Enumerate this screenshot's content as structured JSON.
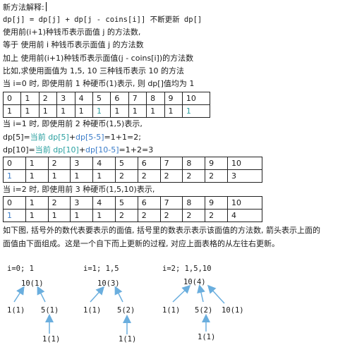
{
  "lines": {
    "l1": "新方法解释:",
    "l2": "dp[j] = dp[j] + dp[j - coins[i]] 不断更新 dp[]",
    "l3": "使用前(i+1)种钱币表示面值 j 的方法数,",
    "l4": "等于   使用前 i 种钱币表示面值 j 的方法数",
    "l5": "加上   使用前(i+1)种钱币表示面值(j - coins[i])的方法数",
    "l6": "比如,求使用面值为 1,5, 10 三种钱币表示 10 的方法",
    "l7": "当 i=0 时, 即使用前 1 种硬币(1)表示, 则 dp[]值均为 1",
    "l8": "当 i=1 时, 即使用前 2 种硬币(1,5)表示,",
    "l10": "当 i=2 时, 即使用前 3 种硬币(1,5,10)表示,",
    "l11": "如下图, 括号外的数代表要表示的面值, 括号里的数表示表示该面值的方法数, 箭头表示上面的",
    "l12": "面值由下面组成。这是一个自下而上更新的过程, 对应上面表格的从左往右更新。"
  },
  "eq1": {
    "a": "dp[5]=",
    "b": "当前 dp[5]",
    "c": "+",
    "d": "dp[5-5]",
    "e": "=1+1=2;"
  },
  "eq2": {
    "a": "dp[10]=",
    "b": "当前 dp[10]",
    "c": "+",
    "d": "dp[10-5]",
    "e": "=1+2=3"
  },
  "colors": {
    "highlight_teal": "#2aa0a0",
    "highlight_blue": "#3a7cc9",
    "arrow": "#6aaede"
  },
  "tables": {
    "t1": {
      "header": [
        "0",
        "1",
        "2",
        "3",
        "4",
        "5",
        "6",
        "7",
        "8",
        "9",
        "10"
      ],
      "values": [
        "1",
        "1",
        "1",
        "1",
        "1",
        "1",
        "1",
        "1",
        "1",
        "1",
        "1"
      ]
    },
    "t2": {
      "header": [
        "0",
        "1",
        "2",
        "3",
        "4",
        "5",
        "6",
        "7",
        "8",
        "9",
        "10"
      ],
      "values": [
        "1",
        "1",
        "1",
        "1",
        "1",
        "2",
        "2",
        "2",
        "2",
        "2",
        "3"
      ]
    },
    "t3": {
      "header": [
        "0",
        "1",
        "2",
        "3",
        "4",
        "5",
        "6",
        "7",
        "8",
        "9",
        "10"
      ],
      "values": [
        "1",
        "1",
        "1",
        "1",
        "1",
        "2",
        "2",
        "2",
        "2",
        "2",
        "4"
      ]
    }
  },
  "trees": [
    {
      "title": "i=0; 1",
      "root": "10(1)",
      "children": [
        "1(1)",
        "5(1)"
      ],
      "grandchild": "1(1)"
    },
    {
      "title": "i=1; 1,5",
      "root": "10(3)",
      "children": [
        "1(1)",
        "5(2)"
      ],
      "grandchild": "1(1)"
    },
    {
      "title": "i=2; 1,5,10",
      "root": "10(4)",
      "children": [
        "1(1)",
        "5(2)",
        "10(1)"
      ],
      "grandchild": "1(1)"
    }
  ]
}
